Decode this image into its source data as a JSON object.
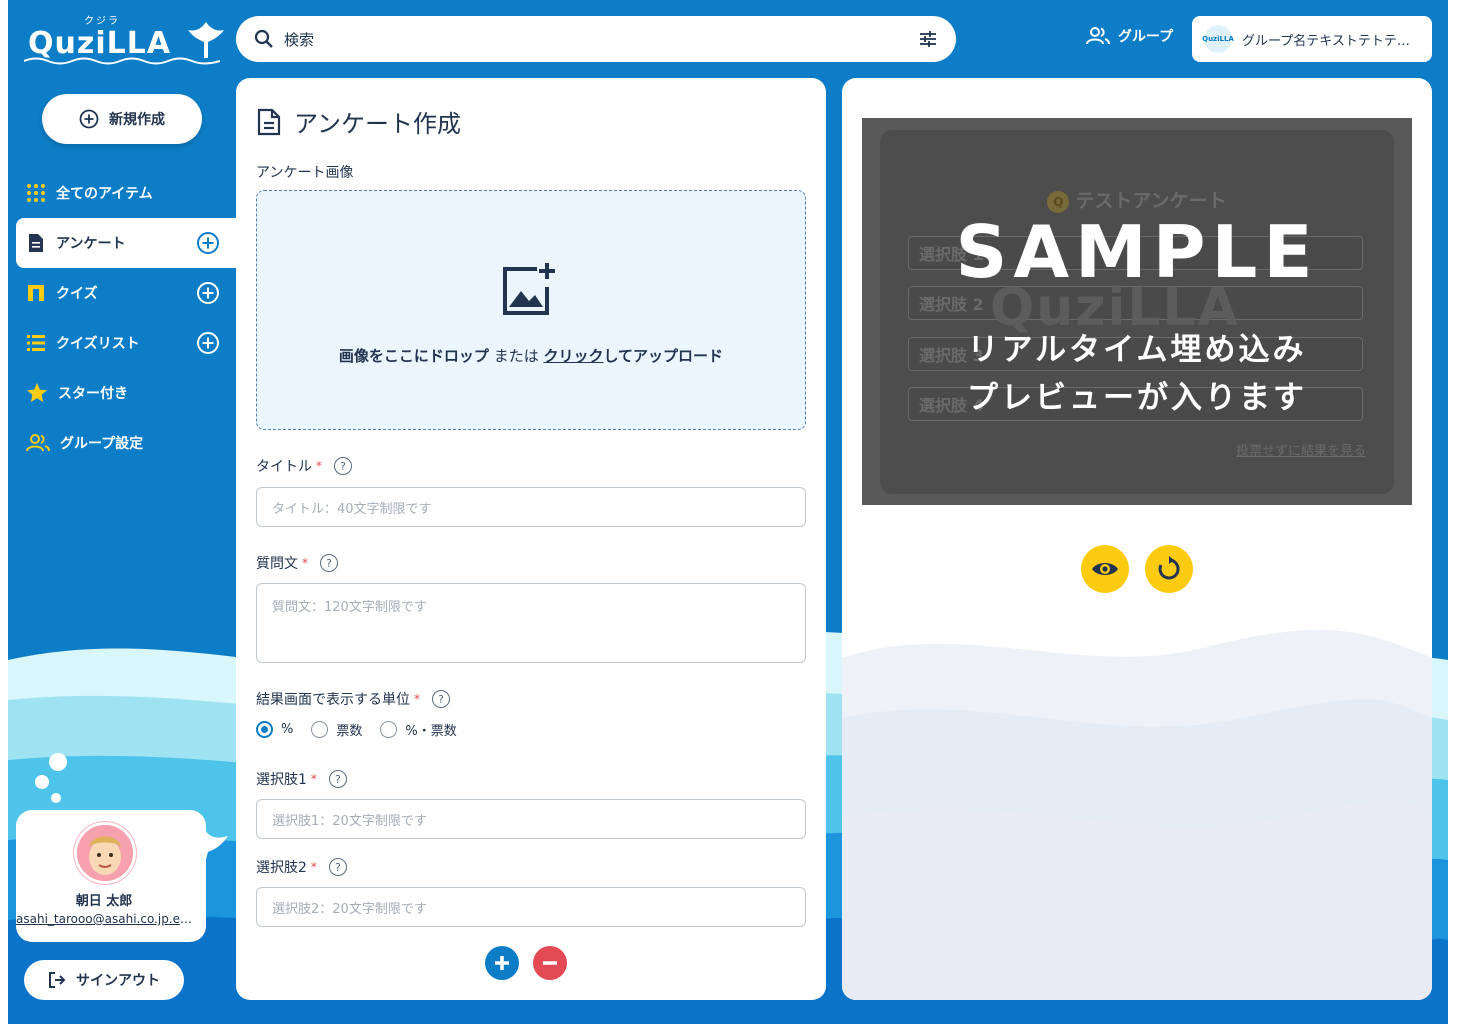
{
  "header": {
    "logo_text": "QuziLLA",
    "logo_kana": "クジラ",
    "search_placeholder": "検索",
    "group_label": "グループ",
    "group_name": "グループ名テキストテトテキストテキスト",
    "group_icon_text": "QuziLLA"
  },
  "sidebar": {
    "new_label": "新規作成",
    "items": [
      {
        "label": "全てのアイテム",
        "icon": "grid-dots-icon",
        "plus": false
      },
      {
        "label": "アンケート",
        "icon": "document-icon",
        "plus": true,
        "active": true
      },
      {
        "label": "クイズ",
        "icon": "quiz-icon",
        "plus": true
      },
      {
        "label": "クイズリスト",
        "icon": "list-icon",
        "plus": true
      },
      {
        "label": "スター付き",
        "icon": "star-icon",
        "plus": false
      },
      {
        "label": "グループ設定",
        "icon": "group-settings-icon",
        "plus": false
      }
    ],
    "user": {
      "name": "朝日 太郎",
      "email": "asahi_tarooo@asahi.co.jp.example"
    },
    "signout_label": "サインアウト"
  },
  "form": {
    "title": "アンケート作成",
    "image_label": "アンケート画像",
    "dropzone": {
      "part1": "画像をここにドロップ",
      "part2": " または ",
      "part3": "クリック",
      "part4": "してアップロード"
    },
    "title_label": "タイトル",
    "title_placeholder": "タイトル：40文字制限です",
    "question_label": "質問文",
    "question_placeholder": "質問文：120文字制限です",
    "unit_label": "結果画面で表示する単位",
    "unit_options": [
      "%",
      "票数",
      "%・票数"
    ],
    "unit_selected": 0,
    "choice1_label": "選択肢1",
    "choice1_placeholder": "選択肢1：20文字制限です",
    "choice2_label": "選択肢2",
    "choice2_placeholder": "選択肢2：20文字制限です",
    "required_mark": "*",
    "help_mark": "?"
  },
  "preview": {
    "question_title": "テストアンケート",
    "options": [
      "選択肢 1",
      "選択肢 2",
      "選択肢 3",
      "選択肢 4"
    ],
    "result_link": "投票せずに結果を見る",
    "sample_label": "SAMPLE",
    "message_line1": "リアルタイム埋め込み",
    "message_line2": "プレビューが入ります",
    "preview_logo": "QuziLLA"
  },
  "colors": {
    "brand_blue": "#0d7dc7",
    "accent_yellow": "#fccb12",
    "remove_red": "#e34a54",
    "text_dark": "#22344f"
  }
}
